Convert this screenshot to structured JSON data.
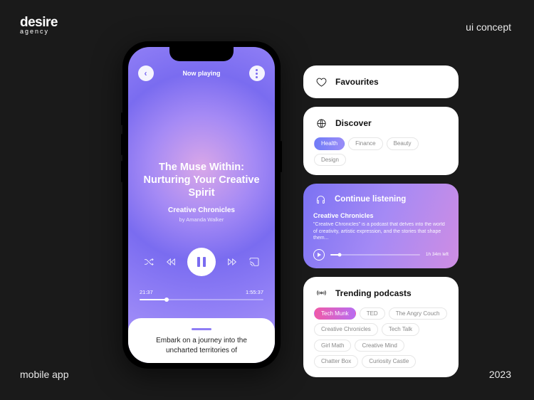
{
  "meta": {
    "brand": "desire",
    "brand_sub": "agency",
    "tr": "ui concept",
    "bl": "mobile app",
    "br": "2023"
  },
  "player": {
    "now_playing_label": "Now playing",
    "title": "The Muse Within: Nurturing Your Creative Spirit",
    "show": "Creative Chronicles",
    "byline": "by Amanda Walker",
    "time_elapsed": "21:37",
    "time_total": "1:55:37",
    "sheet_text": "Embark on a journey into the uncharted territories of"
  },
  "cards": {
    "favourites": {
      "title": "Favourites"
    },
    "discover": {
      "title": "Discover",
      "chips": [
        "Health",
        "Finance",
        "Beauty",
        "Design"
      ],
      "active_index": 0
    },
    "continue": {
      "title": "Continue listening",
      "show": "Creative Chronicles",
      "desc": "\"Creative Chronicles\" is a podcast that delves into the world of creativity, artistic expression, and the stories that shape them...",
      "remaining": "1h 34m left"
    },
    "trending": {
      "title": "Trending podcasts",
      "chips": [
        "Tech Munk",
        "TED",
        "The Angry Couch",
        "Creative Chronicles",
        "Tech Talk",
        "Girl Math",
        "Creative Mind",
        "Chatter Box",
        "Curiosity Castle"
      ],
      "active_index": 0
    }
  }
}
